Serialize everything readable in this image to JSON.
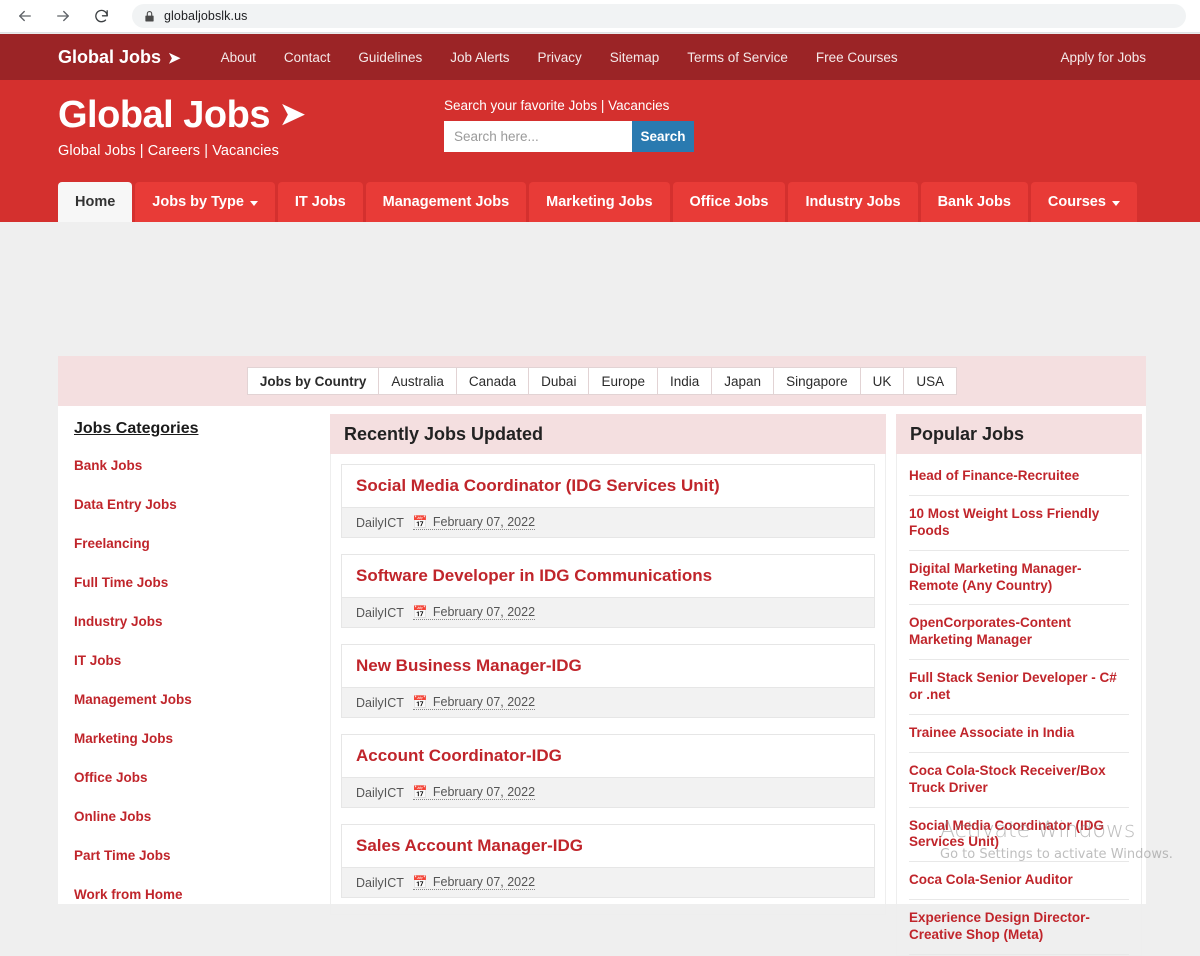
{
  "browser": {
    "url": "globaljobslk.us",
    "back_icon": "back-arrow-icon",
    "forward_icon": "forward-arrow-icon",
    "reload_icon": "reload-icon",
    "lock_icon": "lock-icon"
  },
  "topnav": {
    "brand": "Global Jobs",
    "brand_arrow": "➤",
    "links": [
      "About",
      "Contact",
      "Guidelines",
      "Job Alerts",
      "Privacy",
      "Sitemap",
      "Terms of Service",
      "Free Courses"
    ],
    "apply": "Apply for Jobs"
  },
  "header": {
    "logo": "Global Jobs",
    "logo_arrow": "➤",
    "tagline": "Global Jobs | Careers | Vacancies",
    "search_label": "Search your favorite Jobs | Vacancies",
    "search_placeholder": "Search here...",
    "search_value": "",
    "search_button": "Search"
  },
  "tabs": [
    {
      "label": "Home",
      "active": true,
      "caret": false
    },
    {
      "label": "Jobs by Type",
      "active": false,
      "caret": true
    },
    {
      "label": "IT Jobs",
      "active": false,
      "caret": false
    },
    {
      "label": "Management Jobs",
      "active": false,
      "caret": false
    },
    {
      "label": "Marketing Jobs",
      "active": false,
      "caret": false
    },
    {
      "label": "Office Jobs",
      "active": false,
      "caret": false
    },
    {
      "label": "Industry Jobs",
      "active": false,
      "caret": false
    },
    {
      "label": "Bank Jobs",
      "active": false,
      "caret": false
    },
    {
      "label": "Courses",
      "active": false,
      "caret": true
    }
  ],
  "countries": [
    "Jobs by Country",
    "Australia",
    "Canada",
    "Dubai",
    "Europe",
    "India",
    "Japan",
    "Singapore",
    "UK",
    "USA"
  ],
  "categories": {
    "title": "Jobs Categories",
    "items": [
      "Bank Jobs",
      "Data Entry Jobs",
      "Freelancing",
      "Full Time Jobs",
      "Industry Jobs",
      "IT Jobs",
      "Management Jobs",
      "Marketing Jobs",
      "Office Jobs",
      "Online Jobs",
      "Part Time Jobs",
      "Work from Home"
    ]
  },
  "recent": {
    "title": "Recently Jobs Updated",
    "jobs": [
      {
        "title": "Social Media Coordinator (IDG Services Unit)",
        "author": "DailyICT",
        "date": "February 07, 2022"
      },
      {
        "title": "Software Developer in IDG Communications",
        "author": "DailyICT",
        "date": "February 07, 2022"
      },
      {
        "title": "New Business Manager-IDG",
        "author": "DailyICT",
        "date": "February 07, 2022"
      },
      {
        "title": "Account Coordinator-IDG",
        "author": "DailyICT",
        "date": "February 07, 2022"
      },
      {
        "title": "Sales Account Manager-IDG",
        "author": "DailyICT",
        "date": "February 07, 2022"
      }
    ]
  },
  "popular": {
    "title": "Popular Jobs",
    "items": [
      "Head of Finance-Recruitee",
      "10 Most Weight Loss Friendly Foods",
      "Digital Marketing Manager-Remote (Any Country)",
      "OpenCorporates-Content Marketing Manager",
      "Full Stack Senior Developer - C# or .net",
      "Trainee Associate in India",
      "Coca Cola-Stock Receiver/Box Truck Driver",
      "Social Media Coordinator (IDG Services Unit)",
      "Coca Cola-Senior Auditor",
      "Experience Design Director-Creative Shop (Meta)"
    ]
  },
  "watermark": {
    "line1": "Activate Windows",
    "line2": "Go to Settings to activate Windows."
  },
  "colors": {
    "topnav": "#9b2426",
    "header": "#d4302e",
    "tab": "#e83b37",
    "accent_link": "#c0252b",
    "search_button": "#2a7ab0",
    "panel_head": "#f4dfe0"
  }
}
